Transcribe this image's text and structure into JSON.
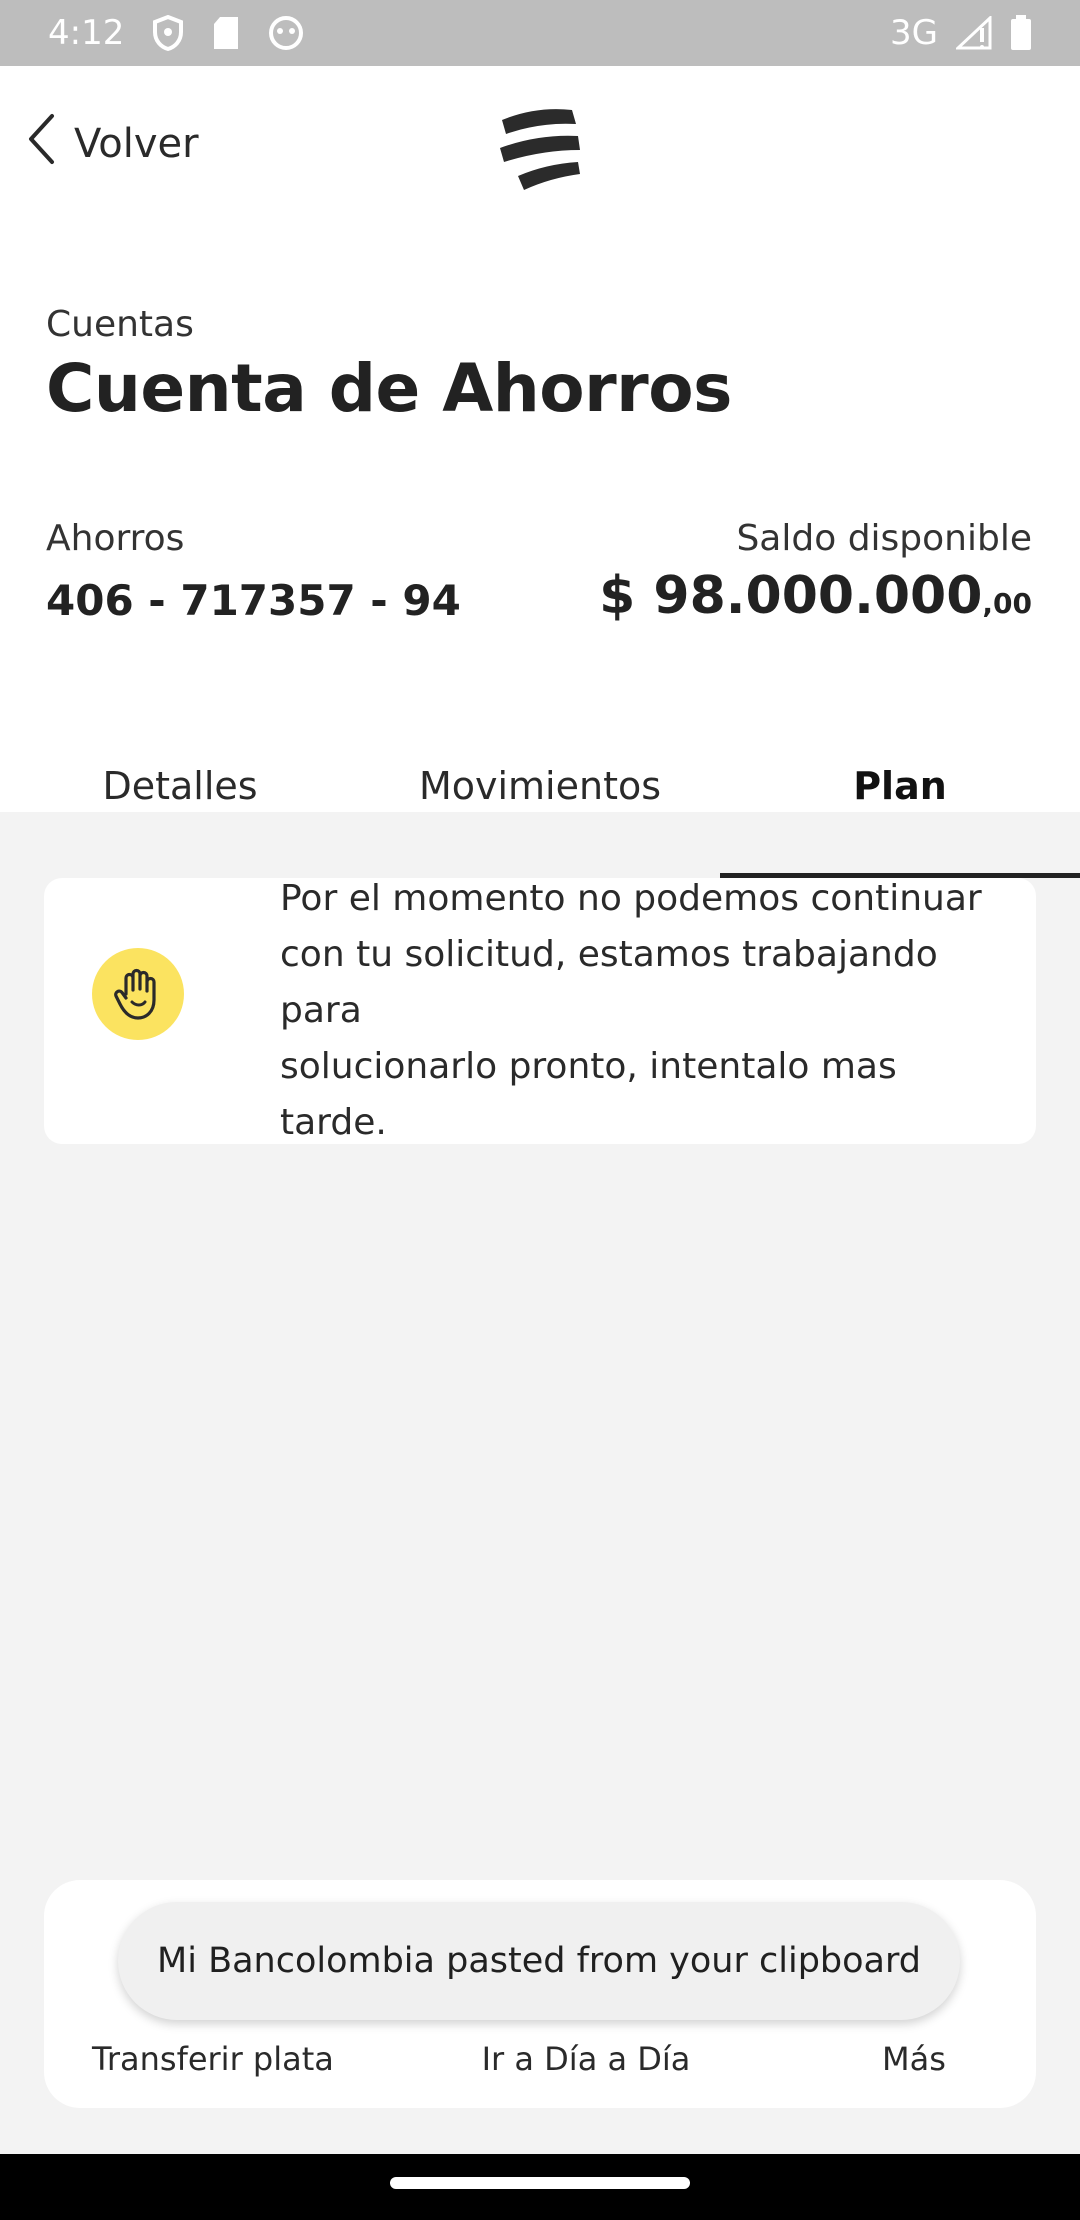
{
  "status_bar": {
    "time": "4:12",
    "network": "3G"
  },
  "header": {
    "back_label": "Volver",
    "section_label": "Cuentas",
    "title": "Cuenta de Ahorros"
  },
  "account": {
    "type": "Ahorros",
    "number": "406 - 717357 - 94",
    "balance_label": "Saldo disponible",
    "balance_main": "$ 98.000.000",
    "balance_cents": ",00"
  },
  "tabs": [
    {
      "label": "Detalles",
      "active": false
    },
    {
      "label": "Movimientos",
      "active": false
    },
    {
      "label": "Plan",
      "active": true
    }
  ],
  "message": {
    "icon": "hand-stop-icon",
    "lines": [
      "Por el momento no podemos continuar",
      "con tu solicitud, estamos trabajando para",
      "solucionarlo pronto, intentalo mas tarde."
    ]
  },
  "actions": [
    {
      "label": "Transferir plata"
    },
    {
      "label": "Ir a Día a Día"
    },
    {
      "label": "Más"
    }
  ],
  "toast": {
    "text": "Mi Bancolombia pasted from your clipboard"
  },
  "colors": {
    "accent_yellow": "#fbe360",
    "status_bar": "#bdbdbd",
    "background": "#f3f3f3"
  }
}
